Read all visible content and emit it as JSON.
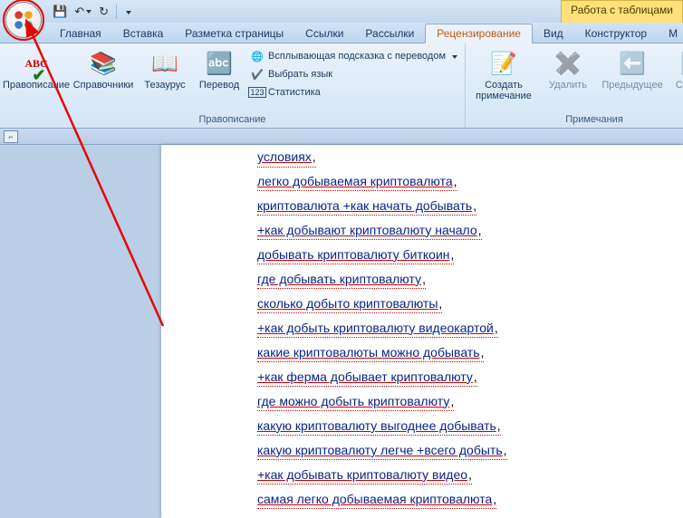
{
  "context_tab": "Работа с таблицами",
  "qat": {
    "save": "💾",
    "undo": "↶",
    "redo": "↻"
  },
  "tabs": [
    {
      "label": "Главная"
    },
    {
      "label": "Вставка"
    },
    {
      "label": "Разметка страницы"
    },
    {
      "label": "Ссылки"
    },
    {
      "label": "Рассылки"
    },
    {
      "label": "Рецензирование",
      "active": true
    },
    {
      "label": "Вид"
    },
    {
      "label": "Конструктор"
    },
    {
      "label": "М"
    }
  ],
  "ribbon": {
    "group1": {
      "label": "Правописание",
      "spelling": "Правописание",
      "references": "Справочники",
      "thesaurus": "Тезаурус",
      "translate": "Перевод",
      "tooltip_translate": "Всплывающая подсказка с переводом",
      "set_language": "Выбрать язык",
      "statistics": "Статистика"
    },
    "group2": {
      "label": "Примечания",
      "new_comment": "Создать\nпримечание",
      "delete": "Удалить",
      "previous": "Предыдущее",
      "next": "Следую"
    }
  },
  "ruler_corner": "⌐",
  "doc_rows": [
    "условиях",
    "легко добываемая криптовалюта",
    "криптовалюта +как начать добывать",
    "+как добывают криптовалюту начало",
    "добывать криптовалюту биткоин",
    "где добывать криптовалюту",
    "сколько добыто криптовалюты",
    "+как добыть криптовалюту видеокартой",
    "какие криптовалюты можно добывать",
    "+как ферма добывает криптовалюту",
    "где можно добыть криптовалюту",
    "какую криптовалюту выгоднее добывать",
    "какую криптовалюту легче +всего добыть",
    "+как добывать криптовалюту видео",
    "самая легко добываемая криптовалюта"
  ]
}
